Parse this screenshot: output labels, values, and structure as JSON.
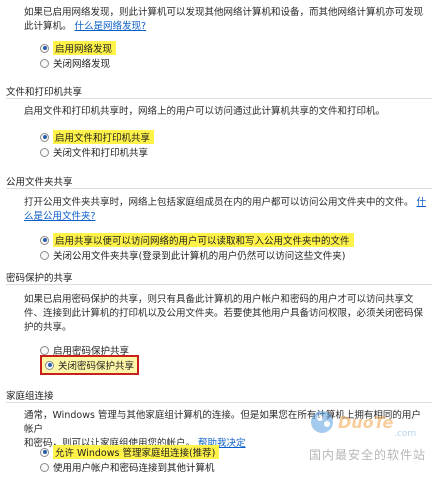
{
  "network_discovery": {
    "desc": "如果已启用网络发现，则此计算机可以发现其他网络计算机和设备，而其他网络计算机亦可发现此计算机。",
    "link": "什么是网络发现?",
    "options": [
      {
        "label": "启用网络发现",
        "checked": true
      },
      {
        "label": "关闭网络发现",
        "checked": false
      }
    ]
  },
  "file_printer": {
    "title": "文件和打印机共享",
    "desc": "启用文件和打印机共享时，网络上的用户可以访问通过此计算机共享的文件和打印机。",
    "options": [
      {
        "label": "启用文件和打印机共享",
        "checked": true
      },
      {
        "label": "关闭文件和打印机共享",
        "checked": false
      }
    ]
  },
  "public_folder": {
    "title": "公用文件夹共享",
    "desc": "打开公用文件夹共享时，网络上包括家庭组成员在内的用户都可以访问公用文件夹中的文件。",
    "link_prefix": "什么",
    "link_rest": "是公用文件夹?",
    "options": [
      {
        "label": "启用共享以便可以访问网络的用户可以读取和写入公用文件夹中的文件",
        "checked": true
      },
      {
        "label": "关闭公用文件夹共享(登录到此计算机的用户仍然可以访问这些文件夹)",
        "checked": false
      }
    ]
  },
  "password": {
    "title": "密码保护的共享",
    "desc": "如果已启用密码保护的共享，则只有具备此计算机的用户帐户和密码的用户才可以访问共享文件、连接到此计算机的打印机以及公用文件夹。若要使其他用户具备访问权限，必须关闭密码保护的共享。",
    "options": [
      {
        "label": "启用密码保护共享",
        "checked": false
      },
      {
        "label": "关闭密码保护共享",
        "checked": true
      }
    ]
  },
  "homegroup": {
    "title": "家庭组连接",
    "desc_1": "通常，Windows 管理与其他家庭组计算机的连接。但是如果您在所有计算机上拥有相同的用户帐户",
    "desc_2": "和密码，则可以让家庭组使用您的帐户。",
    "link": "帮助我决定",
    "options": [
      {
        "label": "允许 Windows 管理家庭组连接(推荐)",
        "checked": true
      },
      {
        "label": "使用用户帐户和密码连接到其他计算机",
        "checked": false
      }
    ]
  },
  "watermark": {
    "logo_text": "DuoTe.com",
    "sub_text": "国内最安全的软件站"
  }
}
